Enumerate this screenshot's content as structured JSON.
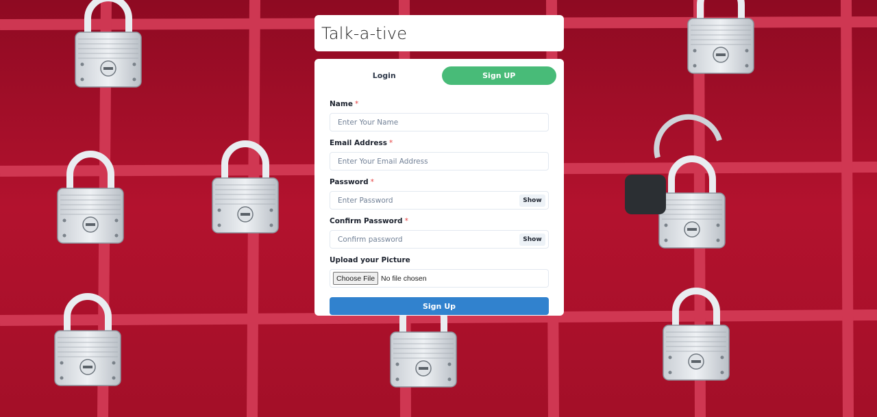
{
  "app": {
    "title": "Talk-a-tive"
  },
  "tabs": [
    {
      "label": "Login",
      "active": false
    },
    {
      "label": "Sign UP",
      "active": true
    }
  ],
  "form": {
    "name": {
      "label": "Name",
      "required_mark": "*",
      "placeholder": "Enter Your Name",
      "value": ""
    },
    "email": {
      "label": "Email Address",
      "required_mark": "*",
      "placeholder": "Enter Your Email Address",
      "value": ""
    },
    "password": {
      "label": "Password",
      "required_mark": "*",
      "placeholder": "Enter Password",
      "value": "",
      "toggle_label": "Show"
    },
    "confirm_password": {
      "label": "Confirm Password",
      "required_mark": "*",
      "placeholder": "Confirm password",
      "value": "",
      "toggle_label": "Show"
    },
    "picture": {
      "label": "Upload your Picture",
      "button_label": "Choose File",
      "status": "No file chosen"
    },
    "submit_label": "Sign Up"
  },
  "colors": {
    "background_red": "#a8102a",
    "grid_red": "#d23a55",
    "active_tab": "#48bb78",
    "submit": "#3182ce",
    "required": "#e53e3e"
  },
  "background": {
    "description_icon": "padlock-icon"
  }
}
